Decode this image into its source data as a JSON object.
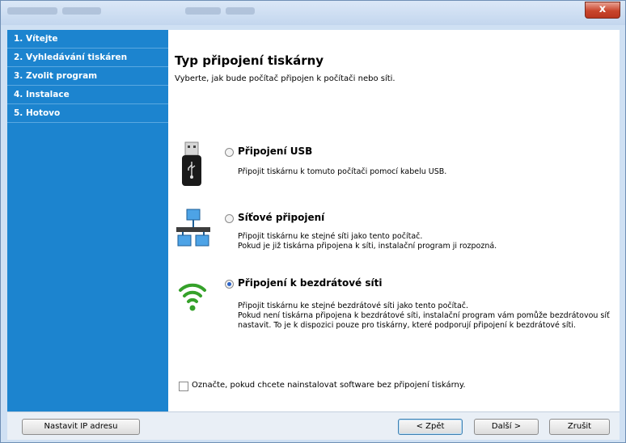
{
  "window": {
    "close_glyph": "x"
  },
  "sidebar": {
    "steps": [
      {
        "label": "1. Vítejte"
      },
      {
        "label": "2. Vyhledávání tiskáren"
      },
      {
        "label": "3. Zvolit program"
      },
      {
        "label": "4. Instalace"
      },
      {
        "label": "5. Hotovo"
      }
    ]
  },
  "main": {
    "title": "Typ připojení tiskárny",
    "subtitle": "Vyberte, jak bude počítač připojen k počítači nebo síti.",
    "options": [
      {
        "title": "Připojení USB",
        "icon": "usb-drive-icon",
        "selected": false,
        "lines": [
          "Připojit tiskárnu k tomuto počítači pomocí kabelu USB."
        ]
      },
      {
        "title": "Síťové připojení",
        "icon": "network-icon",
        "selected": false,
        "lines": [
          "Připojit tiskárnu ke stejné síti jako tento počítač.",
          "Pokud je již tiskárna připojena k síti, instalační program ji rozpozná."
        ]
      },
      {
        "title": "Připojení k bezdrátové síti",
        "icon": "wifi-icon",
        "selected": true,
        "lines": [
          "Připojit tiskárnu ke stejné bezdrátové síti jako tento počítač.",
          "Pokud není tiskárna připojena k bezdrátové síti, instalační program vám pomůže bezdrátovou síť",
          "nastavit. To je k dispozici pouze pro tiskárny, které podporují připojení k bezdrátové síti."
        ]
      }
    ],
    "no_printer_checkbox": {
      "label": "Označte, pokud chcete nainstalovat software bez připojení tiskárny.",
      "checked": false
    }
  },
  "buttons": {
    "set_ip": "Nastavit IP adresu",
    "back": "< Zpět",
    "next": "Další >",
    "cancel": "Zrušit"
  },
  "colors": {
    "sidebar": "#1c84cf",
    "accent": "#2b63c8",
    "wifi": "#35a12a"
  }
}
